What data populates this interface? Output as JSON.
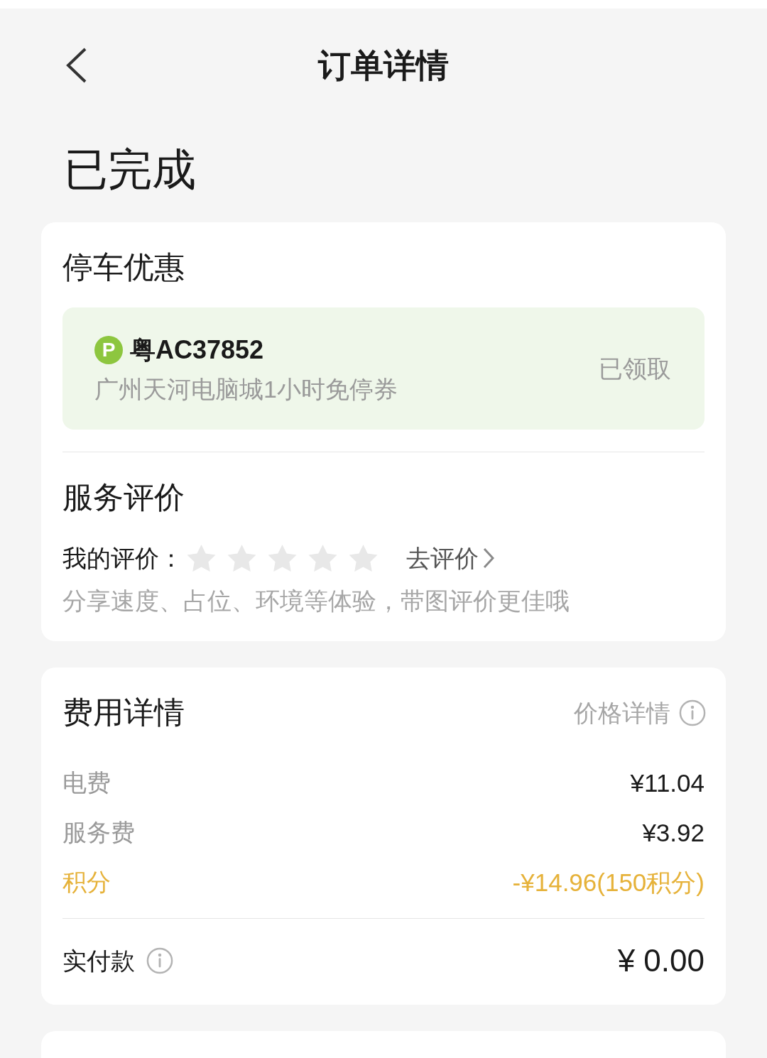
{
  "header": {
    "title": "订单详情"
  },
  "status": "已完成",
  "parking": {
    "title": "停车优惠",
    "coupon": {
      "badge": "P",
      "plate": "粤AC37852",
      "description": "广州天河电脑城1小时免停券",
      "status": "已领取"
    }
  },
  "review": {
    "title": "服务评价",
    "label": "我的评价：",
    "stars": 0,
    "action": "去评价",
    "hint": "分享速度、占位、环境等体验，带图评价更佳哦"
  },
  "fees": {
    "title": "费用详情",
    "link": "价格详情",
    "items": [
      {
        "kind": "normal",
        "label": "电费",
        "amount": "¥11.04"
      },
      {
        "kind": "normal",
        "label": "服务费",
        "amount": "¥3.92"
      },
      {
        "kind": "points",
        "label": "积分",
        "amount": "-¥14.96(150积分)"
      }
    ],
    "total": {
      "label": "实付款",
      "amount": "¥ 0.00"
    }
  }
}
